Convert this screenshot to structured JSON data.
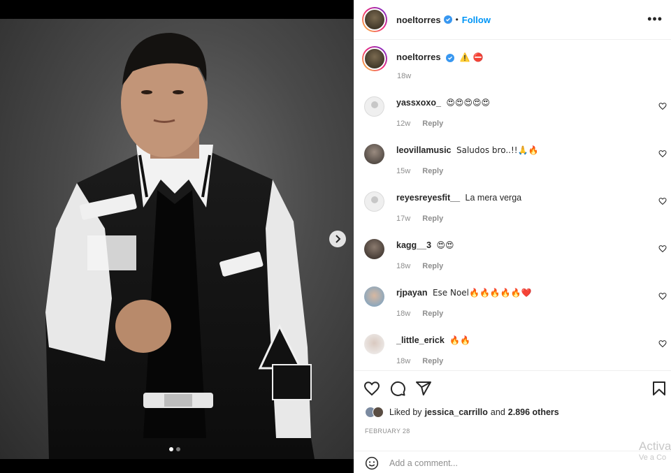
{
  "post": {
    "username": "noeltorres",
    "follow_label": "Follow",
    "separator": "•",
    "more_label": "•••",
    "next_label": "›",
    "photo_count": 2,
    "photo_index": 1
  },
  "caption": {
    "username": "noeltorres",
    "text": "⚠️ ⛔",
    "time": "18w"
  },
  "comments": [
    {
      "username": "yassxoxo_",
      "text": "😍😍😍😍😍",
      "time": "12w",
      "reply": "Reply"
    },
    {
      "username": "leovillamusic",
      "text": "Saludos bro..!!🙏🔥",
      "time": "15w",
      "reply": "Reply"
    },
    {
      "username": "reyesreyesfit__",
      "text": "La mera verga",
      "time": "17w",
      "reply": "Reply"
    },
    {
      "username": "kagg__3",
      "text": "😍😍",
      "time": "18w",
      "reply": "Reply"
    },
    {
      "username": "rjpayan",
      "text": "Ese Noel🔥🔥🔥🔥🔥❤️",
      "time": "18w",
      "reply": "Reply"
    },
    {
      "username": "_little_erick",
      "text": "🔥🔥",
      "time": "18w",
      "reply": "Reply"
    }
  ],
  "likes": {
    "prefix": "Liked by",
    "user": "jessica_carrillo",
    "joiner": "and",
    "others": "2.896 others"
  },
  "date": "FEBRUARY 28",
  "add_comment": {
    "placeholder": "Add a comment..."
  },
  "watermark": {
    "line1": "Activa",
    "line2": "Ve a Co"
  },
  "colors": {
    "accent": "#0095f6",
    "verified": "#3897f0",
    "text": "#262626",
    "muted": "#8e8e8e"
  }
}
